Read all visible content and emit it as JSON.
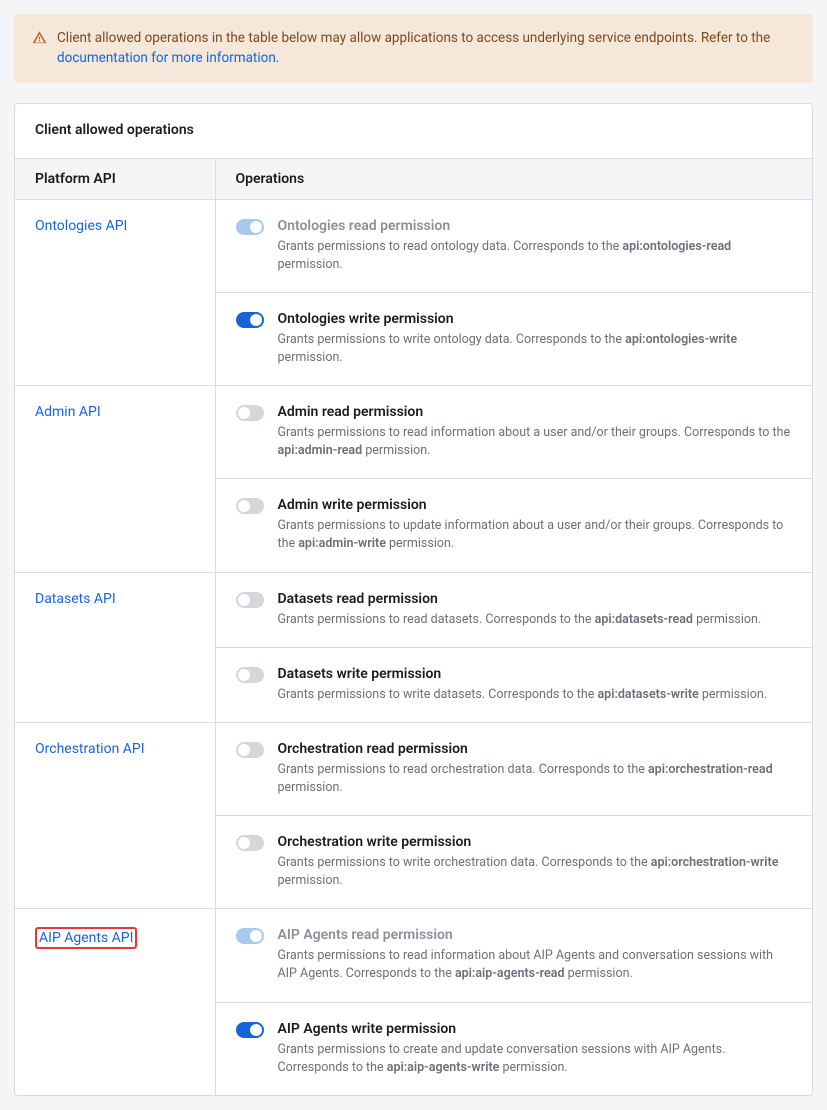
{
  "alert": {
    "text_pre": "Client allowed operations in the table below may allow applications to access underlying service endpoints. Refer to the ",
    "link": "documentation for more information.",
    "icon": "warning-icon"
  },
  "card": {
    "title": "Client allowed operations",
    "columns": {
      "api": "Platform API",
      "ops": "Operations"
    }
  },
  "apis": [
    {
      "name": "Ontologies API",
      "highlighted": false,
      "ops": [
        {
          "toggle": "on-disabled",
          "muted": true,
          "title": "Ontologies read permission",
          "desc_pre": "Grants permissions to read ontology data. Corresponds to the ",
          "code": "api:ontologies-read",
          "desc_post": " permission."
        },
        {
          "toggle": "on-active",
          "muted": false,
          "title": "Ontologies write permission",
          "desc_pre": "Grants permissions to write ontology data. Corresponds to the ",
          "code": "api:ontologies-write",
          "desc_post": " permission."
        }
      ]
    },
    {
      "name": "Admin API",
      "highlighted": false,
      "ops": [
        {
          "toggle": "off",
          "muted": false,
          "title": "Admin read permission",
          "desc_pre": "Grants permissions to read information about a user and/or their groups. Corresponds to the ",
          "code": "api:admin-read",
          "desc_post": " permission."
        },
        {
          "toggle": "off",
          "muted": false,
          "title": "Admin write permission",
          "desc_pre": "Grants permissions to update information about a user and/or their groups. Corresponds to the ",
          "code": "api:admin-write",
          "desc_post": " permission."
        }
      ]
    },
    {
      "name": "Datasets API",
      "highlighted": false,
      "ops": [
        {
          "toggle": "off",
          "muted": false,
          "title": "Datasets read permission",
          "desc_pre": "Grants permissions to read datasets. Corresponds to the ",
          "code": "api:datasets-read",
          "desc_post": " permission."
        },
        {
          "toggle": "off",
          "muted": false,
          "title": "Datasets write permission",
          "desc_pre": "Grants permissions to write datasets. Corresponds to the ",
          "code": "api:datasets-write",
          "desc_post": " permission."
        }
      ]
    },
    {
      "name": "Orchestration API",
      "highlighted": false,
      "ops": [
        {
          "toggle": "off",
          "muted": false,
          "title": "Orchestration read permission",
          "desc_pre": "Grants permissions to read orchestration data. Corresponds to the ",
          "code": "api:orchestration-read",
          "desc_post": " permission."
        },
        {
          "toggle": "off",
          "muted": false,
          "title": "Orchestration write permission",
          "desc_pre": "Grants permissions to write orchestration data. Corresponds to the ",
          "code": "api:orchestration-write",
          "desc_post": " permission."
        }
      ]
    },
    {
      "name": "AIP Agents API",
      "highlighted": true,
      "ops": [
        {
          "toggle": "on-disabled",
          "muted": true,
          "title": "AIP Agents read permission",
          "desc_pre": "Grants permissions to read information about AIP Agents and conversation sessions with AIP Agents. Corresponds to the ",
          "code": "api:aip-agents-read",
          "desc_post": " permission."
        },
        {
          "toggle": "on-active",
          "muted": false,
          "title": "AIP Agents write permission",
          "desc_pre": "Grants permissions to create and update conversation sessions with AIP Agents. Corresponds to the ",
          "code": "api:aip-agents-write",
          "desc_post": " permission."
        }
      ]
    }
  ]
}
